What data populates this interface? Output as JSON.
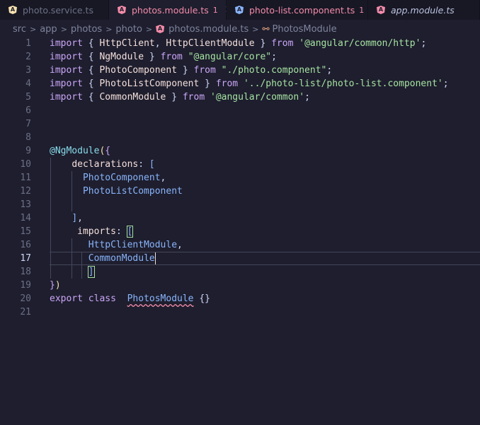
{
  "tabs": [
    {
      "label": "photo.service.ts",
      "badge": "",
      "active": false,
      "color": "#6c7086"
    },
    {
      "label": "photos.module.ts",
      "badge": "1",
      "active": true,
      "color": "#f38ba8"
    },
    {
      "label": "photo-list.component.ts",
      "badge": "1",
      "active": false,
      "color": "#f38ba8"
    },
    {
      "label": "app.module.ts",
      "badge": "",
      "active": false,
      "color": "#bac2de"
    }
  ],
  "close_glyph": "✕",
  "breadcrumb": {
    "parts": [
      "src",
      "app",
      "photos",
      "photo",
      "photos.module.ts",
      "PhotosModule"
    ],
    "separator": ">"
  },
  "editor": {
    "active_line": 17,
    "lines": [
      {
        "n": "1",
        "t": [
          [
            "kw",
            "import"
          ],
          [
            "p",
            " { "
          ],
          [
            "c",
            "HttpClient"
          ],
          [
            "p",
            ", "
          ],
          [
            "c",
            "HttpClientModule"
          ],
          [
            "p",
            " } "
          ],
          [
            "kw",
            "from"
          ],
          [
            "p",
            " "
          ],
          [
            "s",
            "'@angular/common/http'"
          ],
          [
            "p",
            ";"
          ]
        ]
      },
      {
        "n": "2",
        "t": [
          [
            "kw",
            "import"
          ],
          [
            "p",
            " { "
          ],
          [
            "c",
            "NgModule"
          ],
          [
            "p",
            " } "
          ],
          [
            "kw",
            "from"
          ],
          [
            "p",
            " "
          ],
          [
            "s",
            "\"@angular/core\""
          ],
          [
            "p",
            ";"
          ]
        ]
      },
      {
        "n": "3",
        "t": [
          [
            "kw",
            "import"
          ],
          [
            "p",
            " { "
          ],
          [
            "c",
            "PhotoComponent"
          ],
          [
            "p",
            " } "
          ],
          [
            "kw",
            "from"
          ],
          [
            "p",
            " "
          ],
          [
            "s",
            "\"./photo.component\""
          ],
          [
            "p",
            ";"
          ]
        ]
      },
      {
        "n": "4",
        "t": [
          [
            "kw",
            "import"
          ],
          [
            "p",
            " { "
          ],
          [
            "c",
            "PhotoListComponent"
          ],
          [
            "p",
            " } "
          ],
          [
            "kw",
            "from"
          ],
          [
            "p",
            " "
          ],
          [
            "s",
            "'../photo-list/photo-list.component'"
          ],
          [
            "p",
            ";"
          ]
        ]
      },
      {
        "n": "5",
        "t": [
          [
            "kw",
            "import"
          ],
          [
            "p",
            " { "
          ],
          [
            "c",
            "CommonModule"
          ],
          [
            "p",
            " } "
          ],
          [
            "kw",
            "from"
          ],
          [
            "p",
            " "
          ],
          [
            "s",
            "'@angular/common'"
          ],
          [
            "p",
            ";"
          ]
        ]
      },
      {
        "n": "6",
        "t": []
      },
      {
        "n": "7",
        "t": []
      },
      {
        "n": "8",
        "t": []
      },
      {
        "n": "9",
        "t": [
          [
            "d",
            "@NgModule"
          ],
          [
            "b1",
            "("
          ],
          [
            "b2",
            "{"
          ]
        ]
      },
      {
        "n": "10",
        "t": [
          [
            "p",
            "    "
          ],
          [
            "pr",
            "declarations"
          ],
          [
            "p",
            ": "
          ],
          [
            "b3",
            "["
          ]
        ]
      },
      {
        "n": "11",
        "t": [
          [
            "p",
            "      "
          ],
          [
            "cl",
            "PhotoComponent"
          ],
          [
            "p",
            ","
          ]
        ]
      },
      {
        "n": "12",
        "t": [
          [
            "p",
            "      "
          ],
          [
            "cl",
            "PhotoListComponent"
          ]
        ]
      },
      {
        "n": "13",
        "t": []
      },
      {
        "n": "14",
        "t": [
          [
            "p",
            "    "
          ],
          [
            "b3",
            "]"
          ],
          [
            "p",
            ","
          ]
        ]
      },
      {
        "n": "15",
        "t": [
          [
            "p",
            "     "
          ],
          [
            "pr",
            "imports"
          ],
          [
            "p",
            ": "
          ],
          [
            "b3m",
            "["
          ]
        ]
      },
      {
        "n": "16",
        "t": [
          [
            "p",
            "       "
          ],
          [
            "cl",
            "HttpClientModule"
          ],
          [
            "p",
            ","
          ]
        ]
      },
      {
        "n": "17",
        "t": [
          [
            "p",
            "       "
          ],
          [
            "cl",
            "CommonModule"
          ]
        ]
      },
      {
        "n": "18",
        "t": [
          [
            "p",
            "       "
          ],
          [
            "b3m",
            "]"
          ]
        ]
      },
      {
        "n": "19",
        "t": [
          [
            "b2",
            "}"
          ],
          [
            "b1",
            ")"
          ]
        ]
      },
      {
        "n": "20",
        "t": [
          [
            "kw",
            "export"
          ],
          [
            "p",
            " "
          ],
          [
            "kw",
            "class"
          ],
          [
            "p",
            "  "
          ],
          [
            "sq",
            "PhotosModule"
          ],
          [
            "p",
            " {}"
          ]
        ]
      },
      {
        "n": "21",
        "t": []
      }
    ]
  },
  "colors": {
    "background": "#1e1e2e",
    "tabbar": "#181825",
    "keyword": "#cba6f7",
    "string": "#a6e3a1",
    "class_name": "#89b4fa",
    "error": "#f38ba8"
  }
}
